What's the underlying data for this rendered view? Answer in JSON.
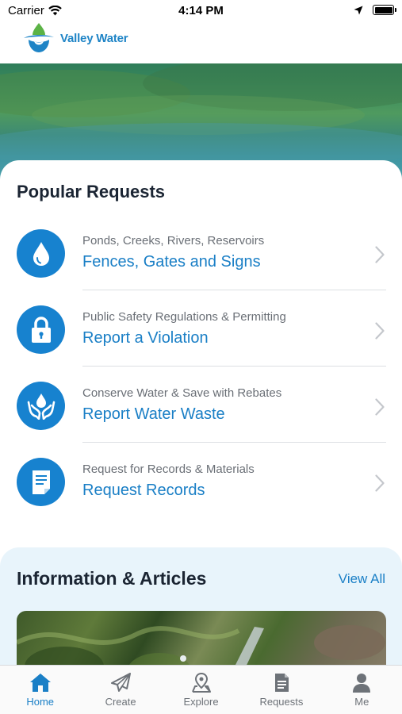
{
  "status_bar": {
    "carrier": "Carrier",
    "time": "4:14 PM"
  },
  "header": {
    "logo_text": "Valley Water"
  },
  "popular_requests": {
    "title": "Popular Requests",
    "items": [
      {
        "subtitle": "Ponds, Creeks, Rivers, Reservoirs",
        "title": "Fences, Gates and Signs",
        "icon": "water-drop-icon"
      },
      {
        "subtitle": "Public Safety Regulations & Permitting",
        "title": "Report a Violation",
        "icon": "padlock-icon"
      },
      {
        "subtitle": "Conserve Water & Save with Rebates",
        "title": "Report Water Waste",
        "icon": "hands-water-drop-icon"
      },
      {
        "subtitle": "Request for Records & Materials",
        "title": "Request Records",
        "icon": "document-icon"
      }
    ]
  },
  "information": {
    "title": "Information & Articles",
    "view_all": "View All"
  },
  "tab_bar": {
    "active": "Home",
    "tabs": [
      {
        "label": "Home",
        "icon": "home-icon"
      },
      {
        "label": "Create",
        "icon": "paper-plane-icon"
      },
      {
        "label": "Explore",
        "icon": "map-pin-icon"
      },
      {
        "label": "Requests",
        "icon": "document-list-icon"
      },
      {
        "label": "Me",
        "icon": "person-icon"
      }
    ]
  },
  "colors": {
    "accent_blue": "#1a7fc6",
    "icon_circle_blue": "#1782cf",
    "info_panel_bg": "#e8f4fb"
  }
}
